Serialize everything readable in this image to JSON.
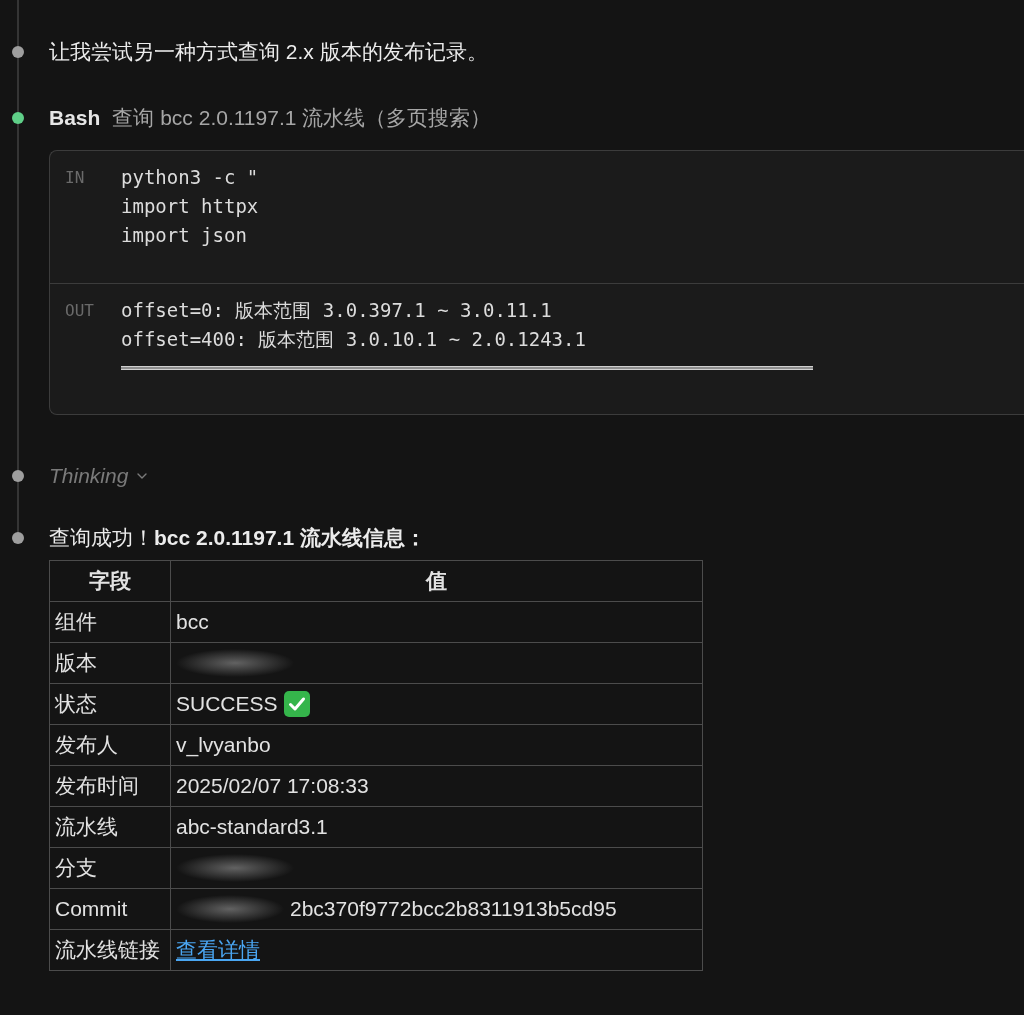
{
  "timeline": [
    {
      "kind": "message",
      "color": "#9e9e9e",
      "text": "让我尝试另一种方式查询 2.x 版本的发布记录。"
    },
    {
      "kind": "tool",
      "color": "#5fcf88",
      "tool": "Bash",
      "description": "查询 bcc 2.0.1197.1 流水线（多页搜索）",
      "input": {
        "label": "IN",
        "lines": [
          "python3 -c \"",
          "import httpx",
          "import json"
        ]
      },
      "output": {
        "label": "OUT",
        "lines": [
          "offset=0: 版本范围 3.0.397.1 ~ 3.0.11.1",
          "offset=400: 版本范围 3.0.10.1 ~ 2.0.1243.1"
        ]
      }
    },
    {
      "kind": "thinking",
      "color": "#9e9e9e",
      "label": "Thinking",
      "expanded": false
    },
    {
      "kind": "answer",
      "color": "#9e9e9e",
      "text": "查询成功！**bcc 2.0.1197.1 流水线信息：**",
      "table": {
        "columns": [
          "字段",
          "值"
        ],
        "rows": [
          {
            "kind": "text",
            "field": "组件",
            "value": "bcc"
          },
          {
            "kind": "redacted",
            "field": "版本"
          },
          {
            "kind": "status",
            "field": "状态",
            "value": "SUCCESS"
          },
          {
            "kind": "text",
            "field": "发布人",
            "value": "v_lvyanbo"
          },
          {
            "kind": "text",
            "field": "发布时间",
            "value": "2025/02/07 17:08:33"
          },
          {
            "kind": "text",
            "field": "流水线",
            "value": "abc-standard3.1"
          },
          {
            "kind": "redacted",
            "field": "分支"
          },
          {
            "kind": "partly_redacted",
            "field": "Commit",
            "value": "2bc370f9772bcc2b8311913b5cd95"
          },
          {
            "kind": "link",
            "field": "流水线链接",
            "value": "查看详情"
          }
        ]
      }
    }
  ]
}
